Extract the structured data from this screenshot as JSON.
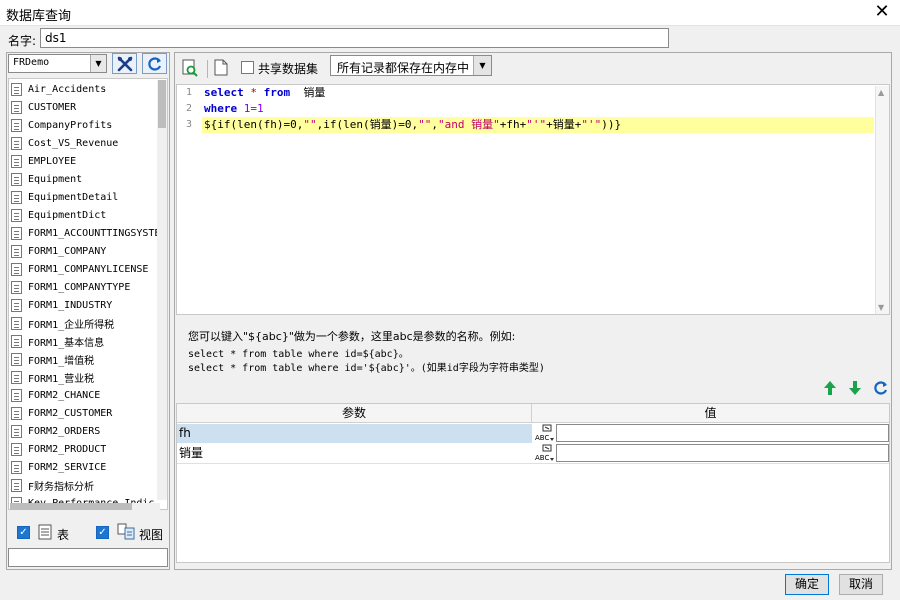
{
  "window": {
    "title": "数据库查询"
  },
  "name": {
    "label": "名字:",
    "value": "ds1"
  },
  "connection": {
    "selected": "FRDemo"
  },
  "tables": [
    "Air_Accidents",
    "CUSTOMER",
    "CompanyProfits",
    "Cost_VS_Revenue",
    "EMPLOYEE",
    "Equipment",
    "EquipmentDetail",
    "EquipmentDict",
    "FORM1_ACCOUNTTINGSYSTE",
    "FORM1_COMPANY",
    "FORM1_COMPANYLICENSE",
    "FORM1_COMPANYTYPE",
    "FORM1_INDUSTRY",
    "FORM1_企业所得税",
    "FORM1_基本信息",
    "FORM1_增值税",
    "FORM1_营业税",
    "FORM2_CHANCE",
    "FORM2_CUSTOMER",
    "FORM2_ORDERS",
    "FORM2_PRODUCT",
    "FORM2_SERVICE",
    "F财务指标分析",
    "Key_Performance_Indic"
  ],
  "filters": {
    "table_label": "表",
    "view_label": "视图",
    "search_value": ""
  },
  "toolbar": {
    "share_label": "共享数据集",
    "policy_value": "所有记录都保存在内存中"
  },
  "sql": {
    "line_numbers": [
      "1",
      "2",
      "3"
    ],
    "line1": {
      "kw1": "select",
      "op": " * ",
      "kw2": "from",
      "rest": "  销量"
    },
    "line2": {
      "kw": "where",
      "num": " 1=1"
    },
    "line3": {
      "p1": "${if(len(fh)=0,",
      "s1": "\"\"",
      "p2": ",if(len(销量)=0,",
      "s2": "\"\"",
      "p3": ",",
      "s3": "\"and 销量\"",
      "p4": "+fh+",
      "s4": "\"'\"",
      "p5": "+销量+",
      "s5": "\"'\"",
      "p6": "))}"
    }
  },
  "hint": {
    "line1": "您可以键入\"${abc}\"做为一个参数，这里abc是参数的名称。例如:",
    "line2": "select * from table where id=${abc}。",
    "line3": "select * from table where id='${abc}'。(如果id字段为字符串类型)"
  },
  "params": {
    "header_name": "参数",
    "header_value": "值",
    "rows": [
      {
        "name": "fh",
        "value": ""
      },
      {
        "name": "销量",
        "value": ""
      }
    ],
    "type_icon_text": "ABC"
  },
  "buttons": {
    "ok": "确定",
    "cancel": "取消"
  },
  "colors": {
    "accent": "#1e76d3",
    "keyword": "#0000d0",
    "string": "#c0006c",
    "highlight": "#ffff9e",
    "selected_row": "#cde0f0"
  }
}
